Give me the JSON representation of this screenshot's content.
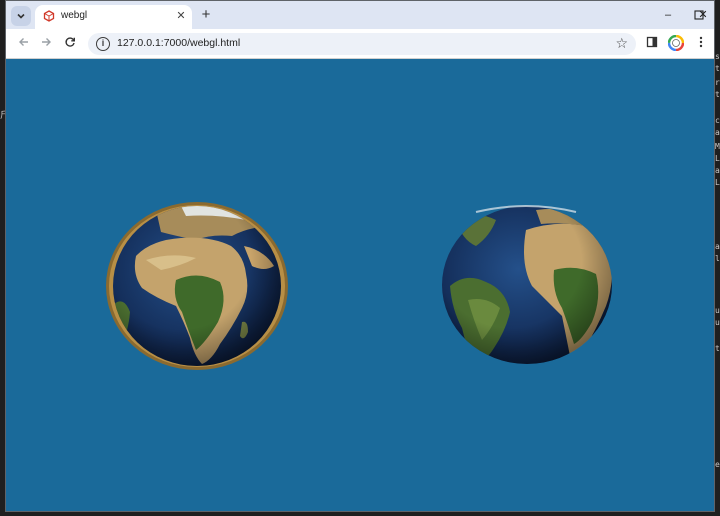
{
  "browser": {
    "tab_title": "webgl",
    "url": "127.0.0.1:7000/webgl.html",
    "new_tab_symbol": "+",
    "close_symbol": "✕"
  },
  "window_controls": {
    "minimize": "–",
    "maximize": "☐",
    "close": "✕"
  },
  "colors": {
    "canvas_background": "#1a6a9a",
    "ocean": "#16305e",
    "land_green": "#3f6a2a",
    "land_desert": "#c2a46f",
    "ring": "#9a7a3a"
  },
  "icons": {
    "tab_search": "chevron-down-icon",
    "favicon": "webgl-cube-icon",
    "back": "arrow-left-icon",
    "forward": "arrow-right-icon",
    "reload": "reload-icon",
    "info": "info-icon",
    "bookmark": "star-icon",
    "sidepanel": "side-panel-icon",
    "profile": "profile-icon",
    "menu": "kebab-menu-icon"
  },
  "scene": {
    "globes": [
      {
        "name": "globe-left-ringed",
        "view": "africa-europe",
        "ring": true
      },
      {
        "name": "globe-right",
        "view": "south-america-africa",
        "ring": false
      }
    ]
  }
}
